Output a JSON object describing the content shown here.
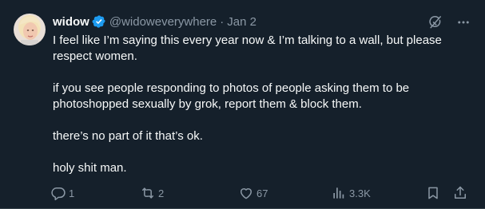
{
  "post": {
    "author": {
      "display_name": "widow",
      "handle": "@widoweverywhere",
      "verified": true
    },
    "separator": "·",
    "date": "Jan 2",
    "paragraphs": [
      "I feel like I’m saying this every year now & I’m talking to a wall, but please respect women.",
      "if you see people responding to photos of people asking them to be photoshopped sexually by grok, report them & block them.",
      "there’s no part of it that’s ok.",
      "holy shit man."
    ],
    "stats": {
      "replies": "1",
      "reposts": "2",
      "likes": "67",
      "views": "3.3K"
    }
  },
  "icons": {
    "verified": "verified-badge-icon",
    "grok": "grok-icon",
    "more": "more-options-icon",
    "reply": "reply-icon",
    "repost": "repost-icon",
    "like": "like-heart-icon",
    "views": "views-chart-icon",
    "bookmark": "bookmark-icon",
    "share": "share-icon"
  },
  "colors": {
    "background": "#15202b",
    "text": "#f7f9f9",
    "muted": "#8b98a5",
    "verified": "#1d9bf0"
  }
}
